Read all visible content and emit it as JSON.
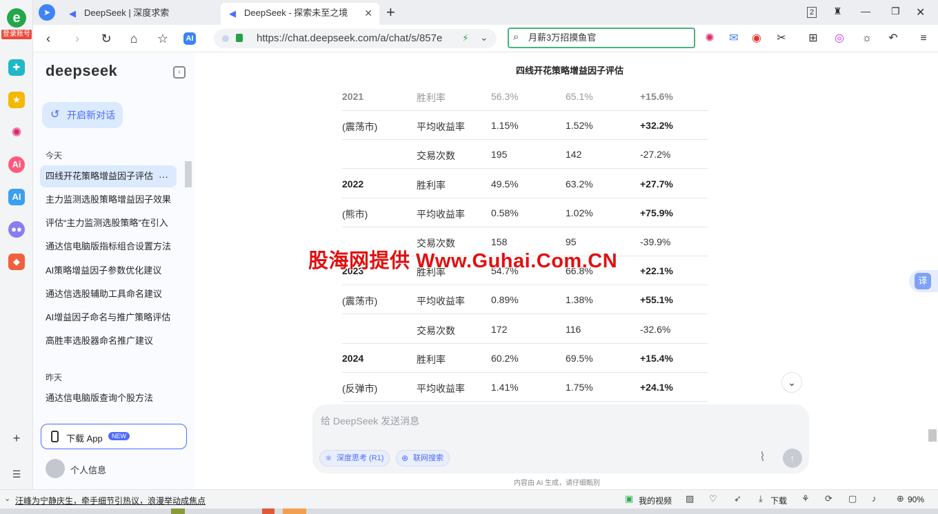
{
  "appbar": {
    "login_label": "登录账号"
  },
  "tabs": [
    {
      "title": "DeepSeek | 深度求索"
    },
    {
      "title": "DeepSeek - 探索未至之境"
    }
  ],
  "tabbar": {
    "tab_count": "2"
  },
  "address": {
    "url": "https://chat.deepseek.com/a/chat/s/857e",
    "search_value": "月薪3万招摸鱼官"
  },
  "sidebar": {
    "logo": "deepseek",
    "new_chat": "开启新对话",
    "today_label": "今天",
    "today_items": [
      "四线开花策略增益因子评估",
      "主力监测选股策略增益因子效果",
      "评估“主力监测选股策略”在引入",
      "通达信电脑版指标组合设置方法",
      "AI策略增益因子参数优化建议",
      "通达信选股辅助工具命名建议",
      "AI增益因子命名与推广策略评估",
      "高胜率选股器命名推广建议"
    ],
    "yesterday_label": "昨天",
    "yesterday_items": [
      "通达信电脑版查询个股方法"
    ],
    "download_app": "下载 App",
    "new_badge": "NEW",
    "profile": "个人信息"
  },
  "table": {
    "title": "四线开花策略增益因子评估",
    "rows": [
      {
        "c1": "2021",
        "c2": "胜利率",
        "c3": "56.3%",
        "c4": "65.1%",
        "c5": "+15.6%"
      },
      {
        "c1": "(震荡市)",
        "c2": "平均收益率",
        "c3": "1.15%",
        "c4": "1.52%",
        "c5": "+32.2%"
      },
      {
        "c1": "",
        "c2": "交易次数",
        "c3": "195",
        "c4": "142",
        "c5": "-27.2%"
      },
      {
        "c1": "2022",
        "c2": "胜利率",
        "c3": "49.5%",
        "c4": "63.2%",
        "c5": "+27.7%"
      },
      {
        "c1": "(熊市)",
        "c2": "平均收益率",
        "c3": "0.58%",
        "c4": "1.02%",
        "c5": "+75.9%"
      },
      {
        "c1": "",
        "c2": "交易次数",
        "c3": "158",
        "c4": "95",
        "c5": "-39.9%"
      },
      {
        "c1": "2023",
        "c2": "胜利率",
        "c3": "54.7%",
        "c4": "66.8%",
        "c5": "+22.1%"
      },
      {
        "c1": "(震荡市)",
        "c2": "平均收益率",
        "c3": "0.89%",
        "c4": "1.38%",
        "c5": "+55.1%"
      },
      {
        "c1": "",
        "c2": "交易次数",
        "c3": "172",
        "c4": "116",
        "c5": "-32.6%"
      },
      {
        "c1": "2024",
        "c2": "胜利率",
        "c3": "60.2%",
        "c4": "69.5%",
        "c5": "+15.4%"
      },
      {
        "c1": "(反弹市)",
        "c2": "平均收益率",
        "c3": "1.41%",
        "c4": "1.75%",
        "c5": "+24.1%"
      }
    ]
  },
  "composer": {
    "placeholder": "给 DeepSeek 发送消息",
    "deep_think": "深度思考 (R1)",
    "web_search": "联网搜索",
    "disclaimer": "内容由 AI 生成，请仔细甄别"
  },
  "translate_label": "译",
  "watermark": "股海网提供 Www.Guhai.Com.CN",
  "statusbar": {
    "news": "汪峰为宁静庆生，牵手细节引热议，浪漫举动成焦点",
    "my_video": "我的视频",
    "download": "下载",
    "zoom": "90%"
  },
  "colors": {
    "accent": "#4d6bfe",
    "active_bg": "#dbeafe",
    "watermark": "#e01010"
  }
}
